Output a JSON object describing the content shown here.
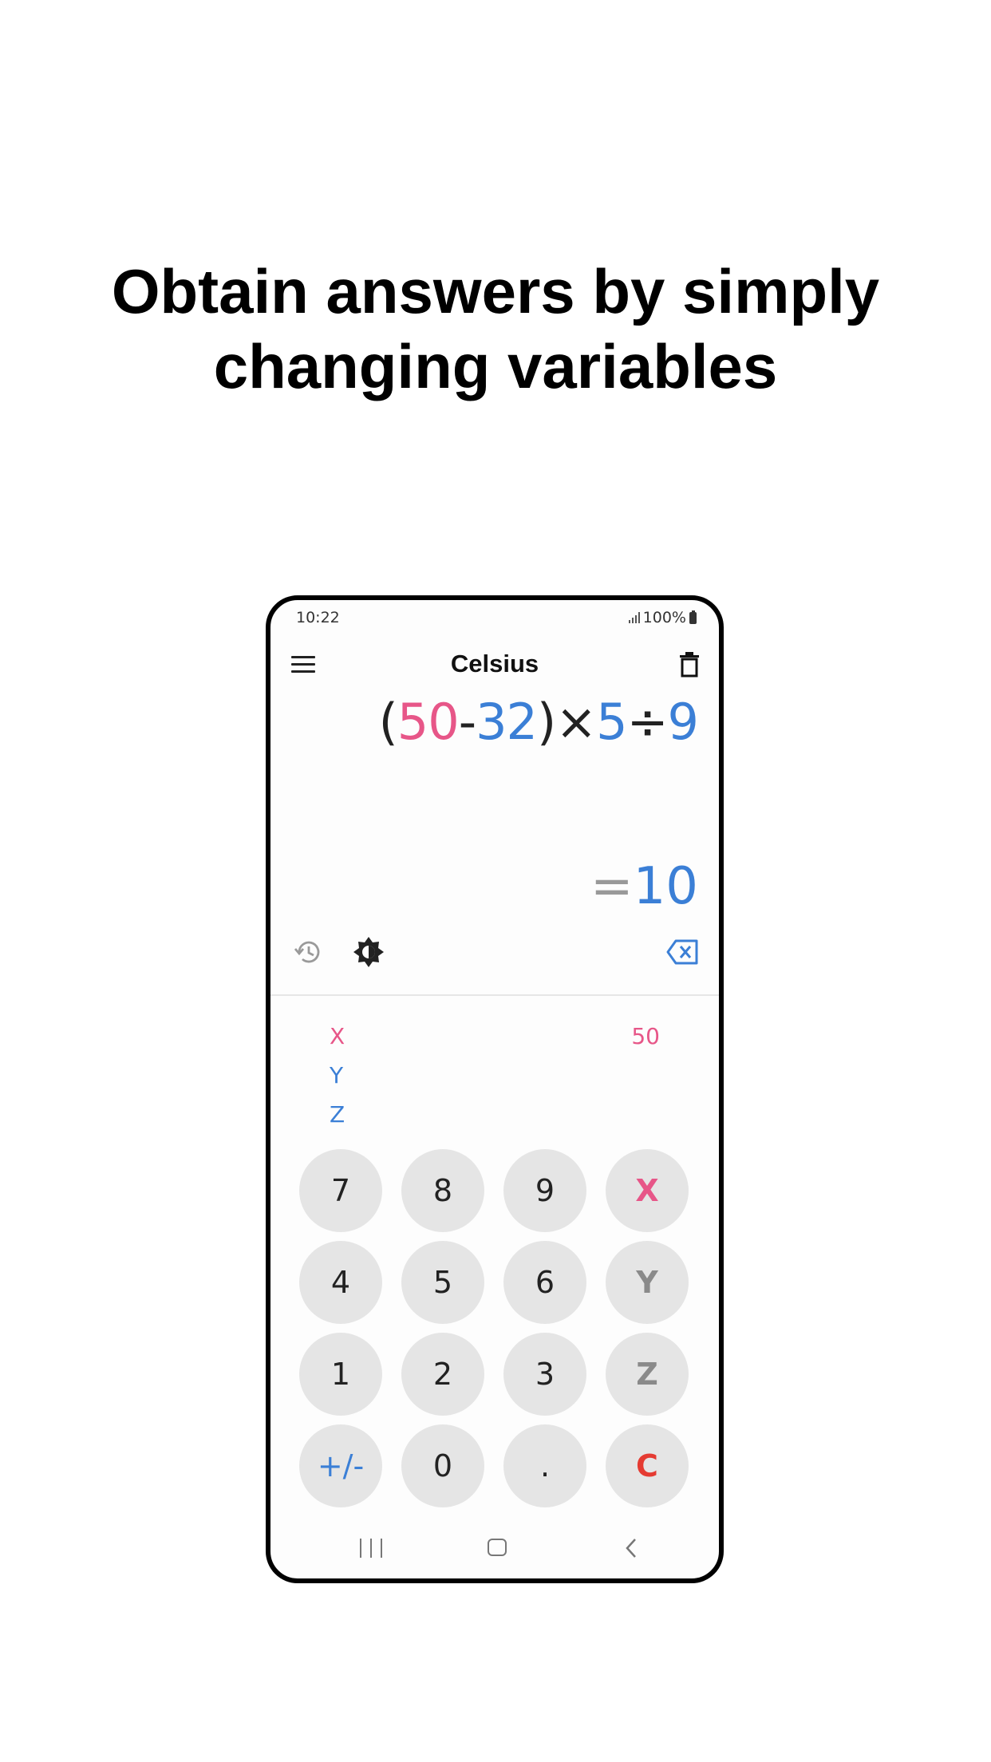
{
  "headline": {
    "line1": "Obtain answers by simply",
    "line2": "changing variables"
  },
  "status_bar": {
    "time": "10:22",
    "battery": "100%"
  },
  "app_bar": {
    "title": "Celsius",
    "menu_icon": "hamburger-menu-icon",
    "trash_icon": "trash-icon"
  },
  "expression": {
    "tokens": [
      {
        "text": "(",
        "color": "#222222"
      },
      {
        "text": "50",
        "color": "#e75688"
      },
      {
        "text": "-",
        "color": "#222222"
      },
      {
        "text": "32",
        "color": "#3b7fd6"
      },
      {
        "text": ")",
        "color": "#222222"
      },
      {
        "text": "×",
        "color": "#222222"
      },
      {
        "text": "5",
        "color": "#3b7fd6"
      },
      {
        "text": "÷",
        "color": "#222222"
      },
      {
        "text": "9",
        "color": "#3b7fd6"
      }
    ]
  },
  "result": {
    "equals": "=",
    "value": "10"
  },
  "tools": {
    "history_icon": "history-icon",
    "theme_icon": "brightness-icon",
    "backspace_icon": "backspace-icon"
  },
  "variables": [
    {
      "name": "X",
      "value": "50",
      "color": "#e75688"
    },
    {
      "name": "Y",
      "value": "",
      "color": "#3b7fd6"
    },
    {
      "name": "Z",
      "value": "",
      "color": "#3b7fd6"
    }
  ],
  "keypad": [
    [
      {
        "label": "7"
      },
      {
        "label": "8"
      },
      {
        "label": "9"
      },
      {
        "label": "X",
        "color": "#e75688",
        "bold": true
      }
    ],
    [
      {
        "label": "4"
      },
      {
        "label": "5"
      },
      {
        "label": "6"
      },
      {
        "label": "Y",
        "color": "#8a8a8a",
        "bold": true
      }
    ],
    [
      {
        "label": "1"
      },
      {
        "label": "2"
      },
      {
        "label": "3"
      },
      {
        "label": "Z",
        "color": "#8a8a8a",
        "bold": true
      }
    ],
    [
      {
        "label": "+/-",
        "color": "#3b7fd6"
      },
      {
        "label": "0"
      },
      {
        "label": "."
      },
      {
        "label": "C",
        "color": "#e53b32",
        "bold": true
      }
    ]
  ],
  "nav_bar": {
    "recent_icon": "recent-apps-icon",
    "home_icon": "home-icon",
    "back_icon": "back-icon"
  },
  "colors": {
    "accent_blue": "#3b7fd6",
    "accent_pink": "#e75688",
    "clear_red": "#e53b32",
    "key_bg": "#e5e5e5"
  }
}
